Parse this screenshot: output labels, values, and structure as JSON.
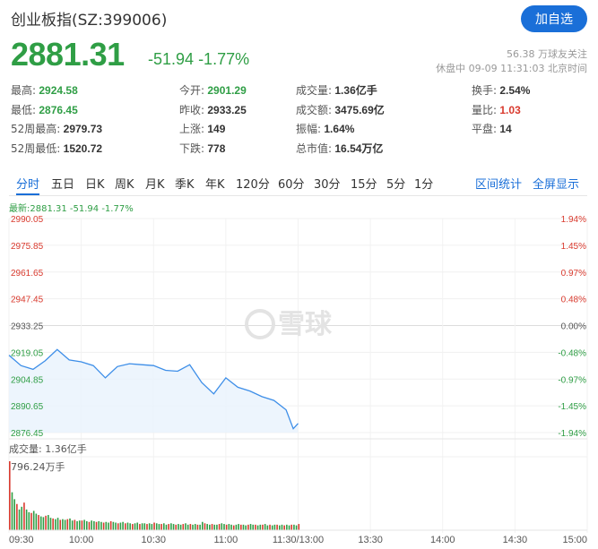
{
  "header": {
    "title": "创业板指(SZ:399006)",
    "follow_label": "加自选",
    "price": "2881.31",
    "change": "-51.94",
    "change_pct": "-1.77%",
    "followers": "56.38 万球友关注",
    "status": "休盘中 09-09 11:31:03 北京时间"
  },
  "stats": [
    {
      "label": "最高:",
      "value": "2924.58",
      "tone": "green"
    },
    {
      "label": "今开:",
      "value": "2901.29",
      "tone": "green"
    },
    {
      "label": "成交量:",
      "value": "1.36亿手",
      "tone": ""
    },
    {
      "label": "换手:",
      "value": "2.54%",
      "tone": ""
    },
    {
      "label": "最低:",
      "value": "2876.45",
      "tone": "green"
    },
    {
      "label": "昨收:",
      "value": "2933.25",
      "tone": ""
    },
    {
      "label": "成交额:",
      "value": "3475.69亿",
      "tone": ""
    },
    {
      "label": "量比:",
      "value": "1.03",
      "tone": "red"
    },
    {
      "label": "52周最高:",
      "value": "2979.73",
      "tone": ""
    },
    {
      "label": "上涨:",
      "value": "149",
      "tone": ""
    },
    {
      "label": "振幅:",
      "value": "1.64%",
      "tone": ""
    },
    {
      "label": "平盘:",
      "value": "14",
      "tone": ""
    },
    {
      "label": "52周最低:",
      "value": "1520.72",
      "tone": ""
    },
    {
      "label": "下跌:",
      "value": "778",
      "tone": ""
    },
    {
      "label": "总市值:",
      "value": "16.54万亿",
      "tone": ""
    }
  ],
  "tabs": [
    "分时",
    "五日",
    "日K",
    "周K",
    "月K",
    "季K",
    "年K",
    "120分",
    "60分",
    "30分",
    "15分",
    "5分",
    "1分"
  ],
  "active_tab": "分时",
  "tab_actions": [
    "区间统计",
    "全屏显示"
  ],
  "latest_line": "最新:2881.31 -51.94 -1.77%",
  "watermark": "雪球",
  "volume_title": "成交量: 1.36亿手",
  "volume_max": "796.24万手",
  "colors": {
    "up": "#d93a2e",
    "down": "#2f9e45",
    "line": "#3d8ee8",
    "accent": "#1a6fd8"
  },
  "chart_data": {
    "type": "line",
    "y_left_ticks": [
      "2990.05",
      "2975.85",
      "2961.65",
      "2947.45",
      "2933.25",
      "2919.05",
      "2904.85",
      "2890.65",
      "2876.45"
    ],
    "y_right_ticks": [
      "1.94%",
      "1.45%",
      "0.97%",
      "0.48%",
      "0.00%",
      "-0.48%",
      "-0.97%",
      "-1.45%",
      "-1.94%"
    ],
    "ylim": [
      2876.45,
      2990.05
    ],
    "prev_close": 2933.25,
    "x_ticks": [
      "09:30",
      "10:00",
      "10:30",
      "11:00",
      "11:30/13:00",
      "13:30",
      "14:00",
      "14:30",
      "15:00"
    ],
    "minutes": [
      0,
      5,
      10,
      15,
      20,
      25,
      30,
      35,
      40,
      45,
      50,
      55,
      60,
      65,
      70,
      75,
      80,
      85,
      90,
      95,
      100,
      105,
      110,
      115,
      118,
      120
    ],
    "prices": [
      2917.5,
      2912.0,
      2910.0,
      2914.5,
      2920.5,
      2915.0,
      2914.0,
      2912.0,
      2905.5,
      2911.5,
      2913.0,
      2912.5,
      2912.0,
      2909.5,
      2909.0,
      2912.5,
      2903.0,
      2897.0,
      2905.5,
      2900.5,
      2898.5,
      2895.5,
      2893.5,
      2888.5,
      2878.5,
      2881.3
    ],
    "volume_series_max": 796.24,
    "volumes": [
      100,
      55,
      45,
      38,
      30,
      34,
      40,
      30,
      26,
      25,
      28,
      24,
      22,
      20,
      19,
      21,
      22,
      18,
      17,
      16,
      18,
      15,
      16,
      15,
      16,
      17,
      14,
      15,
      13,
      14,
      14,
      15,
      13,
      12,
      14,
      13,
      12,
      13,
      12,
      11,
      12,
      11,
      13,
      12,
      11,
      10,
      11,
      12,
      10,
      11,
      10,
      9,
      10,
      11,
      9,
      10,
      10,
      9,
      10,
      9,
      11,
      10,
      9,
      9,
      10,
      8,
      9,
      10,
      9,
      8,
      9,
      8,
      9,
      10,
      8,
      9,
      8,
      9,
      8,
      8,
      12,
      10,
      9,
      8,
      9,
      8,
      8,
      9,
      10,
      9,
      8,
      9,
      8,
      7,
      8,
      9,
      8,
      8,
      7,
      8,
      9,
      8,
      8,
      7,
      8,
      8,
      9,
      7,
      8,
      7,
      8,
      8,
      7,
      8,
      7,
      8,
      7,
      8,
      8,
      7,
      9
    ]
  }
}
